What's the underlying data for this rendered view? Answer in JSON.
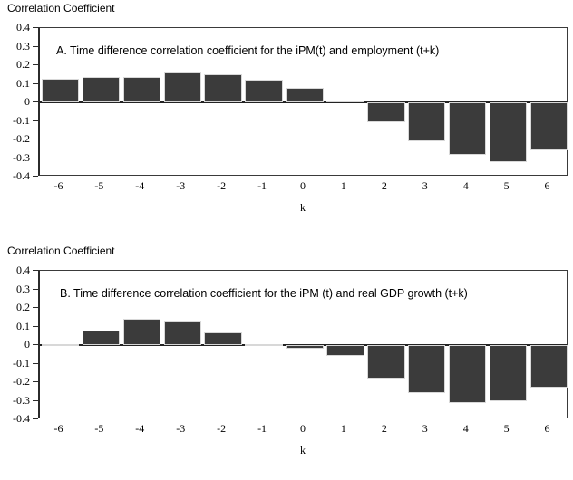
{
  "chart_data": [
    {
      "type": "bar",
      "id": "panel-a",
      "title": "A.  Time difference correlation coefficient for the iPM(t) and employment (t+k)",
      "ylabel_caption": "Correlation Coefficient",
      "xlabel": "k",
      "categories": [
        "-6",
        "-5",
        "-4",
        "-3",
        "-2",
        "-1",
        "0",
        "1",
        "2",
        "3",
        "4",
        "5",
        "6"
      ],
      "values": [
        0.125,
        0.135,
        0.135,
        0.16,
        0.15,
        0.12,
        0.08,
        0.01,
        -0.105,
        -0.21,
        -0.285,
        -0.32,
        -0.26
      ],
      "yticks": [
        "0.4",
        "0.3",
        "0.2",
        "0.1",
        "0",
        "-0.1",
        "-0.2",
        "-0.3",
        "-0.4"
      ],
      "ytickvalues": [
        0.4,
        0.3,
        0.2,
        0.1,
        0,
        -0.1,
        -0.2,
        -0.3,
        -0.4
      ],
      "ylim": [
        -0.4,
        0.4
      ],
      "grid": false,
      "legend": "none",
      "bar_color": "#3b3b3b"
    },
    {
      "type": "bar",
      "id": "panel-b",
      "title": "B. Time difference correlation coefficient for the iPM (t) and real GDP growth (t+k)",
      "ylabel_caption": "Correlation Coefficient",
      "xlabel": "k",
      "categories": [
        "-6",
        "-5",
        "-4",
        "-3",
        "-2",
        "-1",
        "0",
        "1",
        "2",
        "3",
        "4",
        "5",
        "6"
      ],
      "values": [
        0.005,
        0.08,
        0.14,
        0.13,
        0.07,
        0.005,
        -0.02,
        -0.06,
        -0.18,
        -0.26,
        -0.31,
        -0.3,
        -0.23
      ],
      "yticks": [
        "0.4",
        "0.3",
        "0.2",
        "0.1",
        "0",
        "-0.1",
        "-0.2",
        "-0.3",
        "-0.4"
      ],
      "ytickvalues": [
        0.4,
        0.3,
        0.2,
        0.1,
        0,
        -0.1,
        -0.2,
        -0.3,
        -0.4
      ],
      "ylim": [
        -0.4,
        0.4
      ],
      "grid": false,
      "legend": "none",
      "bar_color": "#3b3b3b"
    }
  ],
  "panel_a": {
    "caption": "Correlation Coefficient",
    "title": "A.  Time difference correlation coefficient for the iPM(t) and employment (t+k)",
    "xaxis_title": "k"
  },
  "panel_b": {
    "caption": "Correlation Coefficient",
    "title": "B. Time difference correlation coefficient for the iPM (t) and real GDP growth (t+k)",
    "xaxis_title": "k"
  }
}
